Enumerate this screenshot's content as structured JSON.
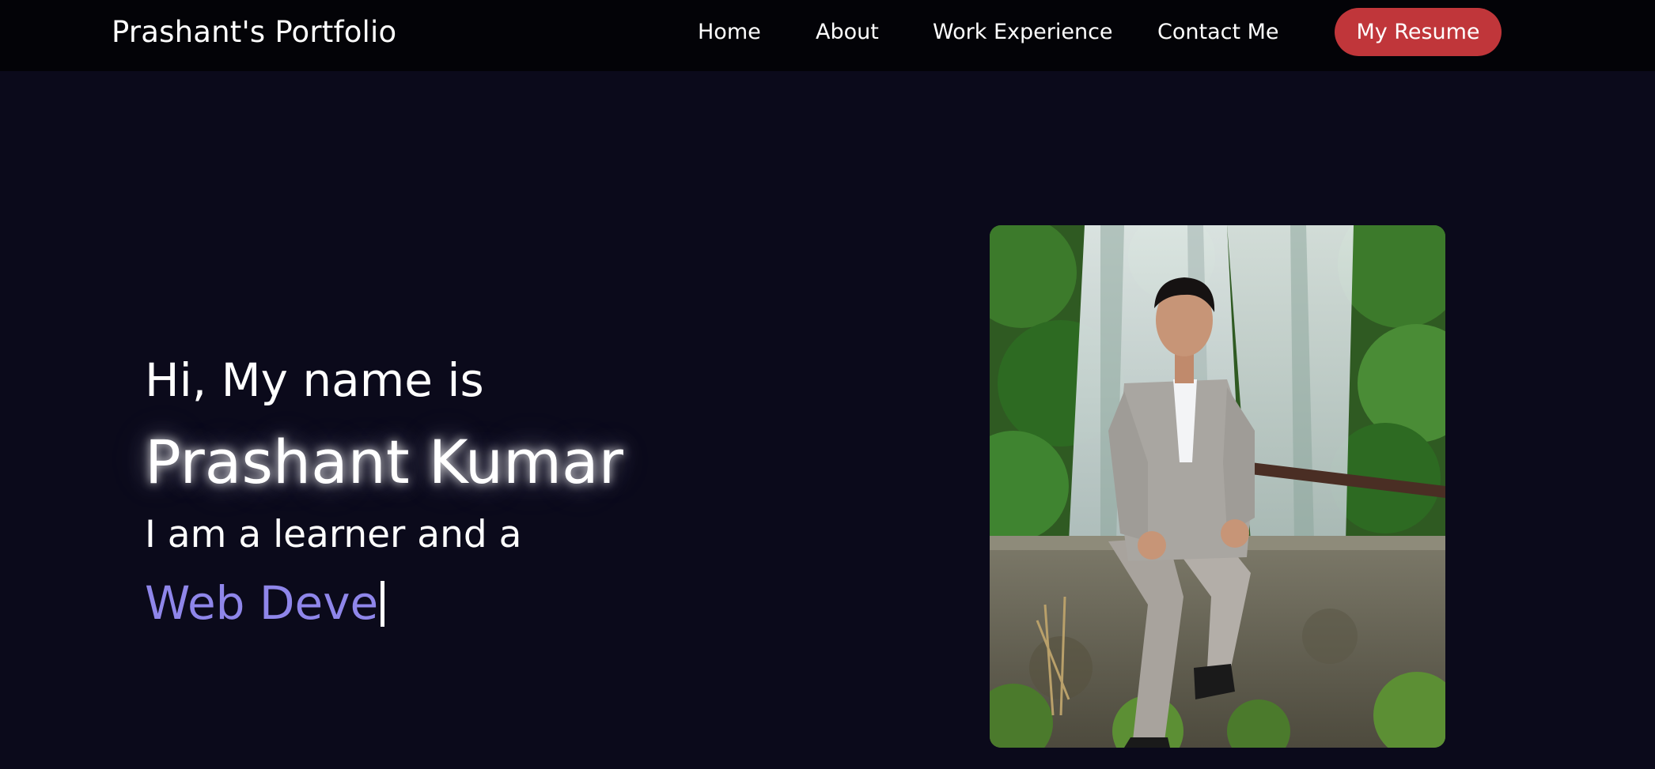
{
  "header": {
    "brand": "Prashant's Portfolio",
    "nav": {
      "home": "Home",
      "about": "About",
      "work": "Work Experience",
      "contact": "Contact Me"
    },
    "resume_label": "My Resume"
  },
  "hero": {
    "greeting": "Hi, My name is",
    "name": "Prashant Kumar",
    "tagline": "I am a learner and a",
    "typed_text": "Web Deve"
  },
  "colors": {
    "background": "#0b0a1b",
    "navbar": "#030307",
    "accent_button": "#c0363a",
    "typed_text": "#8f86ea"
  },
  "icons": {
    "cursor": "text-cursor-icon"
  }
}
